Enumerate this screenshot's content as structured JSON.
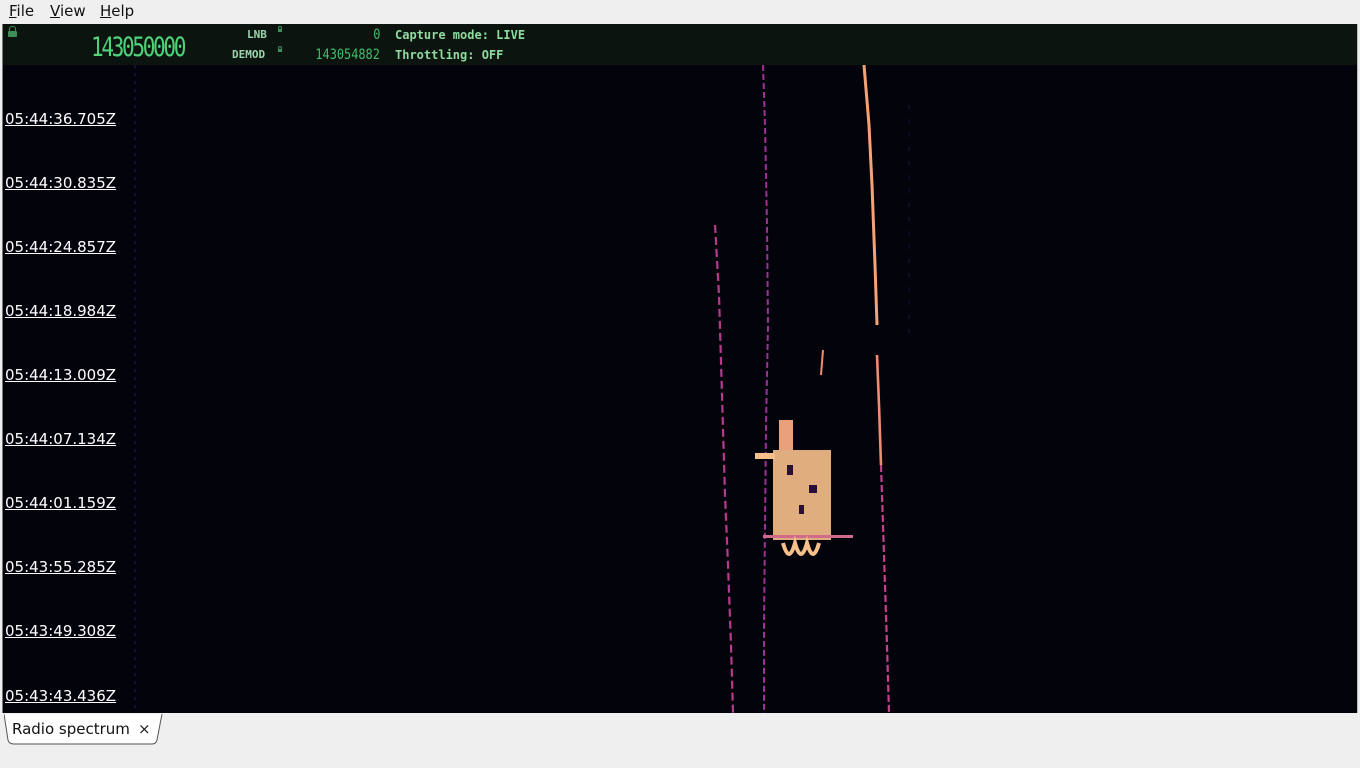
{
  "menu": {
    "file": {
      "mnemonic": "F",
      "rest": "ile"
    },
    "view": {
      "mnemonic": "V",
      "rest": "iew"
    },
    "help": {
      "mnemonic": "H",
      "rest": "elp"
    }
  },
  "status": {
    "frequency": "143050000",
    "lnb_label": "LNB",
    "lnb_value": "0",
    "demod_label": "DEMOD",
    "demod_value": "143054882",
    "capture_mode": "Capture mode: LIVE",
    "throttling": "Throttling: OFF",
    "lock_icon": "lock-icon"
  },
  "waterfall": {
    "timestamps": [
      "05:44:36.705Z",
      "05:44:30.835Z",
      "05:44:24.857Z",
      "05:44:18.984Z",
      "05:44:13.009Z",
      "05:44:07.134Z",
      "05:44:01.159Z",
      "05:43:55.285Z",
      "05:43:49.308Z",
      "05:43:43.436Z"
    ],
    "colors": {
      "background": "#03030b",
      "low": "#5a1f8a",
      "mid": "#d1428b",
      "high": "#fcc38a"
    }
  },
  "tabs": [
    {
      "label": "Radio spectrum",
      "close": "×"
    }
  ]
}
